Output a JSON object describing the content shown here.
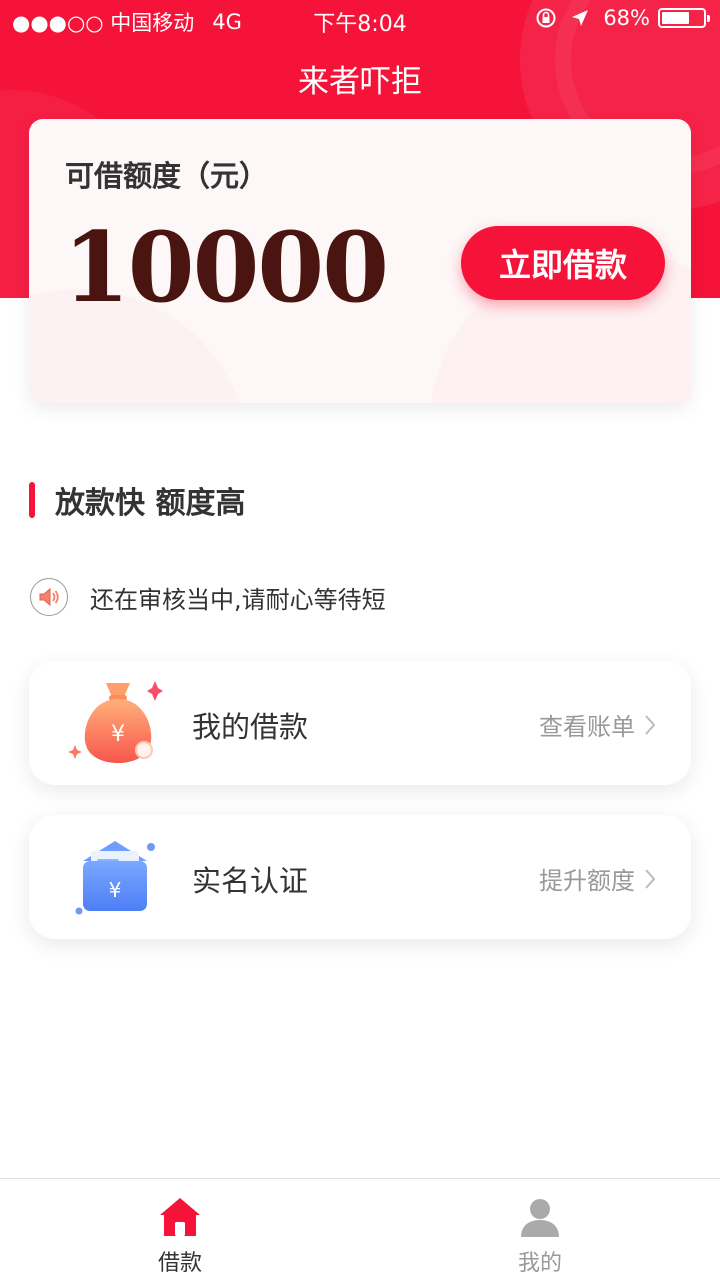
{
  "status_bar": {
    "carrier": "●●●○○ 中国移动",
    "network": "4G",
    "time": "下午8:04",
    "battery_percent": "68%",
    "battery_level": 0.68
  },
  "header": {
    "title": "来者吓拒"
  },
  "credit": {
    "label": "可借额度（元）",
    "amount": "10000",
    "button_label": "立即借款"
  },
  "section": {
    "title": "放款快 额度高"
  },
  "notice": {
    "text": "还在审核当中,请耐心等待短"
  },
  "cards": [
    {
      "icon": "money-bag-icon",
      "title": "我的借款",
      "action": "查看账单"
    },
    {
      "icon": "envelope-yuan-icon",
      "title": "实名认证",
      "action": "提升额度"
    }
  ],
  "tabbar": {
    "tabs": [
      {
        "label": "借款",
        "icon": "home-icon",
        "active": true
      },
      {
        "label": "我的",
        "icon": "user-icon",
        "active": false
      }
    ]
  },
  "colors": {
    "brand_red": "#f5133a",
    "amount_color": "#4a1410",
    "inactive_tab": "#aaaaaa"
  }
}
